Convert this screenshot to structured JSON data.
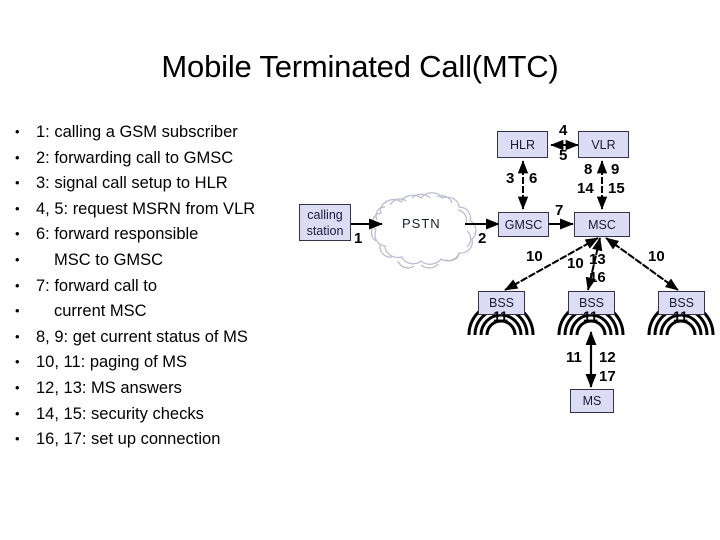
{
  "slide": {
    "title": "Mobile Terminated Call(MTC)"
  },
  "bullets": [
    {
      "text": "1: calling a GSM subscriber",
      "indent": false
    },
    {
      "text": "2: forwarding call to GMSC",
      "indent": false
    },
    {
      "text": "3: signal call setup to HLR",
      "indent": false
    },
    {
      "text": "4, 5: request MSRN from VLR",
      "indent": false
    },
    {
      "text": "6: forward responsible",
      "indent": false
    },
    {
      "text": "MSC to GMSC",
      "indent": true
    },
    {
      "text": "7: forward call to",
      "indent": false
    },
    {
      "text": "current MSC",
      "indent": true
    },
    {
      "text": "8, 9: get current status of MS",
      "indent": false
    },
    {
      "text": "10, 11: paging of MS",
      "indent": false
    },
    {
      "text": "12, 13: MS answers",
      "indent": false
    },
    {
      "text": "14, 15: security checks",
      "indent": false
    },
    {
      "text": "16, 17: set up connection",
      "indent": false
    }
  ],
  "diagram": {
    "nodes": {
      "calling_station_line1": "calling",
      "calling_station_line2": "station",
      "pstn": "PSTN",
      "hlr": "HLR",
      "vlr": "VLR",
      "gmsc": "GMSC",
      "msc": "MSC",
      "bss_left": "BSS",
      "bss_center": "BSS",
      "bss_right": "BSS",
      "ms": "MS"
    },
    "edge_labels": {
      "station_to_pstn": "1",
      "pstn_to_gmsc": "2",
      "gmsc_hlr_up": "3",
      "gmsc_hlr_down": "6",
      "hlr_vlr_top": "4",
      "hlr_vlr_bottom": "5",
      "msc_vlr_8": "8",
      "msc_vlr_9": "9",
      "msc_vlr_14": "14",
      "msc_vlr_15": "15",
      "gmsc_to_msc": "7",
      "msc_bss_left": "10",
      "msc_bss_center_10": "10",
      "msc_bss_center_13": "13",
      "msc_bss_center_16": "16",
      "msc_bss_right": "10",
      "arc_left": "11",
      "arc_center": "11",
      "arc_right": "11",
      "bss_ms_11": "11",
      "bss_ms_12": "12",
      "bss_ms_17": "17"
    },
    "colors": {
      "node_fill": "#dcdcf4",
      "node_border": "#33334d",
      "line": "#000000",
      "cloud_stroke": "#b9b9d0"
    }
  }
}
